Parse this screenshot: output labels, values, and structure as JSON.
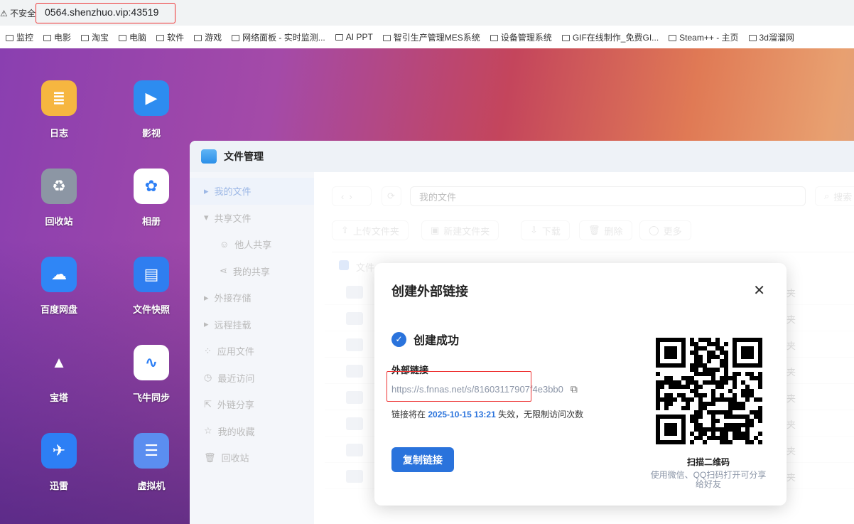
{
  "browser": {
    "insecure_label": "不安全",
    "url": "0564.shenzhuo.vip:43519",
    "bookmarks": [
      "监控",
      "电影",
      "淘宝",
      "电脑",
      "软件",
      "游戏",
      "网络面板 - 实时监测...",
      "AI PPT",
      "智引生产管理MES系统",
      "设备管理系统",
      "GIF在线制作_免费GI...",
      "Steam++ - 主页",
      "3d溜溜网"
    ]
  },
  "desktop": {
    "apps": [
      "日志",
      "影视",
      "回收站",
      "相册",
      "百度网盘",
      "文件快照",
      "宝塔",
      "飞牛同步",
      "迅雷",
      "虚拟机"
    ]
  },
  "window": {
    "title": "文件管理",
    "sidebar": [
      "我的文件",
      "共享文件",
      "他人共享",
      "我的共享",
      "外接存储",
      "远程挂载",
      "应用文件",
      "最近访问",
      "外链分享",
      "我的收藏",
      "回收站"
    ],
    "path": "我的文件",
    "search_placeholder": "搜索",
    "toolbar": [
      "上传文件夹",
      "新建文件夹",
      "下载",
      "删除",
      "更多"
    ],
    "column_file": "文件",
    "row_type": "夹"
  },
  "dialog": {
    "title": "创建外部链接",
    "success": "创建成功",
    "link_label": "外部链接",
    "link": "https://s.fnnas.net/s/81603117907f4e3bb0",
    "expire_prefix": "链接将在",
    "expire_time": "2025-10-15 13:21",
    "expire_suffix": "失效，无限制访问次数",
    "copy_button": "复制链接",
    "qr_title": "扫描二维码",
    "qr_desc": "使用微信、QQ扫码打开可分享给好友"
  },
  "colors": {
    "accent": "#2a73dc",
    "highlight": "#e33333"
  }
}
